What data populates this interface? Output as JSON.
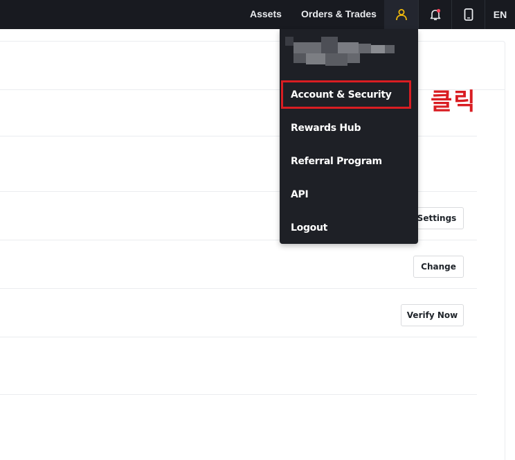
{
  "nav": {
    "assets": "Assets",
    "orders_trades": "Orders & Trades",
    "language": "EN"
  },
  "icons": {
    "user": "user-icon",
    "bell": "bell-icon",
    "phone": "mobile-phone-icon"
  },
  "colors": {
    "topbar": "#181a20",
    "dropdown": "#1e2026",
    "accent": "#f0b90b",
    "notification_dot": "#f6465d",
    "annotation_red": "#d91d22"
  },
  "dropdown": {
    "items": [
      {
        "label": "Account & Security"
      },
      {
        "label": "Rewards Hub"
      },
      {
        "label": "Referral Program"
      },
      {
        "label": "API"
      },
      {
        "label": "Logout"
      }
    ]
  },
  "content": {
    "buttons": {
      "settings": "Settings",
      "change": "Change",
      "verify_now": "Verify Now"
    }
  },
  "annotation": {
    "text": "클릭"
  }
}
